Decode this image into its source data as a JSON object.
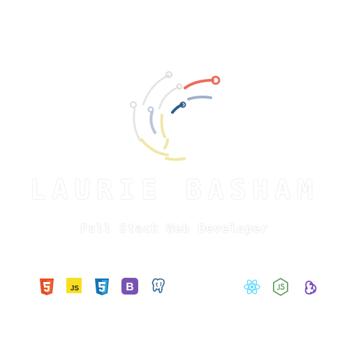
{
  "brand": {
    "name": "LAURIE BASHAM",
    "tagline": "Full Stack Web Developer"
  },
  "colors": {
    "red": "#f06a5a",
    "steel": "#9fb2c8",
    "navy": "#2f5f86",
    "butter": "#f0e7a8"
  },
  "tech_icons": {
    "left": [
      "html5-icon",
      "javascript-icon",
      "css3-icon",
      "bootstrap-icon",
      "postgresql-icon"
    ],
    "right": [
      "react-icon",
      "nodejs-icon",
      "redux-icon"
    ],
    "js_label": "JS",
    "bootstrap_label": "B"
  }
}
